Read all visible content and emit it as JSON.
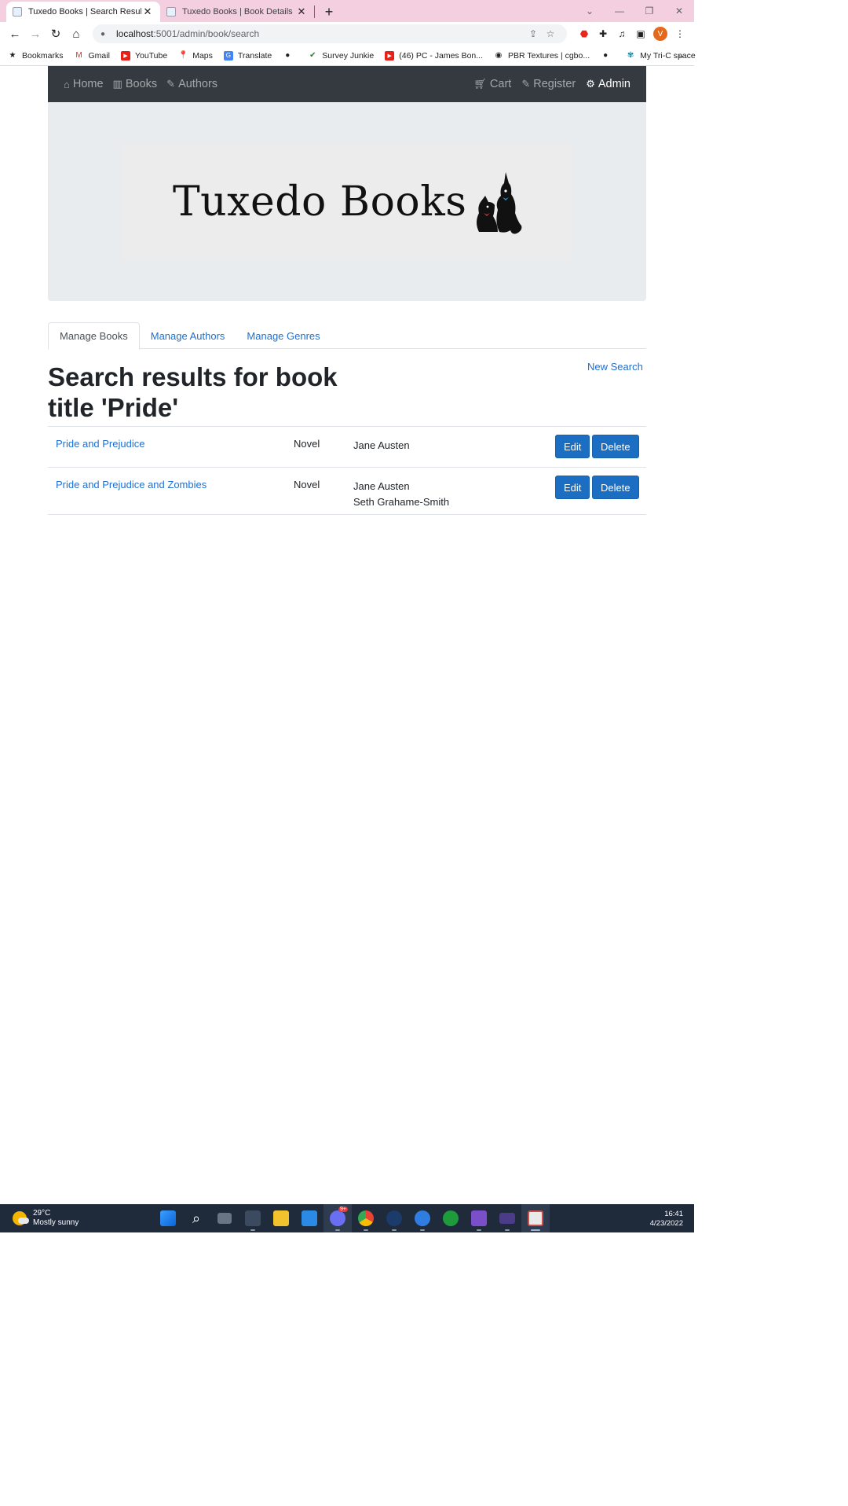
{
  "browser": {
    "tabs": [
      {
        "title": "Tuxedo Books | Search Results",
        "active": true
      },
      {
        "title": "Tuxedo Books | Book Details",
        "active": false
      }
    ],
    "url_host": "localhost",
    "url_path": ":5001/admin/book/search",
    "profile_initial": "V",
    "bookmarks": [
      {
        "label": "Bookmarks",
        "icon": "star-icon"
      },
      {
        "label": "Gmail",
        "icon": "gmail-icon"
      },
      {
        "label": "YouTube",
        "icon": "youtube-icon"
      },
      {
        "label": "Maps",
        "icon": "maps-icon"
      },
      {
        "label": "Translate",
        "icon": "translate-icon"
      },
      {
        "label": "",
        "icon": "globe-icon"
      },
      {
        "label": "Survey Junkie",
        "icon": "survey-icon"
      },
      {
        "label": "(46) PC - James Bon...",
        "icon": "youtube-icon"
      },
      {
        "label": "PBR Textures | cgbo...",
        "icon": "palette-icon"
      },
      {
        "label": "",
        "icon": "globe-icon"
      },
      {
        "label": "My Tri-C space",
        "icon": "tri-c-icon"
      }
    ]
  },
  "nav": {
    "home": "Home",
    "books": "Books",
    "authors": "Authors",
    "cart": "Cart",
    "register": "Register",
    "admin": "Admin"
  },
  "banner": {
    "text": "Tuxedo Books"
  },
  "admin_tabs": [
    {
      "label": "Manage Books",
      "active": true
    },
    {
      "label": "Manage Authors",
      "active": false
    },
    {
      "label": "Manage Genres",
      "active": false
    }
  ],
  "heading": "Search results for book title 'Pride'",
  "new_search": "New Search",
  "results": [
    {
      "title": "Pride and Prejudice",
      "genre": "Novel",
      "authors": [
        "Jane Austen"
      ],
      "edit": "Edit",
      "delete": "Delete"
    },
    {
      "title": "Pride and Prejudice and Zombies",
      "genre": "Novel",
      "authors": [
        "Jane Austen",
        "Seth Grahame-Smith"
      ],
      "edit": "Edit",
      "delete": "Delete"
    }
  ],
  "taskbar": {
    "temperature": "29°C",
    "weather": "Mostly sunny",
    "time": "16:41",
    "date": "4/23/2022",
    "badge": "9+"
  },
  "colors": {
    "link": "#1f6fd0",
    "button": "#1b6ec2",
    "navbar": "#343a40",
    "tabstrip": "#f4cfe0"
  }
}
